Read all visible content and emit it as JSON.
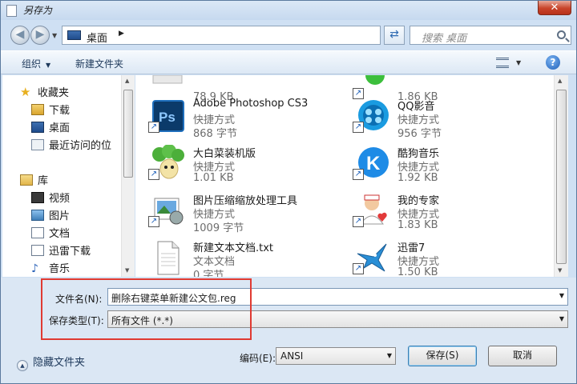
{
  "window": {
    "title": "另存为",
    "close_glyph": "✕"
  },
  "nav": {
    "address_location": "桌面",
    "search_placeholder": "搜索 桌面"
  },
  "toolbar": {
    "organize": "组织",
    "new_folder": "新建文件夹"
  },
  "sidebar": {
    "items": [
      {
        "label": "收藏夹",
        "icon": "star-icon"
      },
      {
        "label": "下载",
        "icon": "downloads-folder-icon"
      },
      {
        "label": "桌面",
        "icon": "desktop-icon"
      },
      {
        "label": "最近访问的位",
        "icon": "recent-places-icon"
      },
      {
        "label": "库",
        "icon": "libraries-icon"
      },
      {
        "label": "视频",
        "icon": "video-library-icon"
      },
      {
        "label": "图片",
        "icon": "pictures-library-icon"
      },
      {
        "label": "文档",
        "icon": "documents-library-icon"
      },
      {
        "label": "迅雷下载",
        "icon": "thunder-download-icon"
      },
      {
        "label": "音乐",
        "icon": "music-library-icon"
      }
    ]
  },
  "files": [
    {
      "name": "",
      "type": "",
      "size": "78.9 KB",
      "icon": "partial-file-icon"
    },
    {
      "name": "",
      "type": "",
      "size": "1.86 KB",
      "icon": "partial-green-app-icon"
    },
    {
      "name": "Adobe Photoshop CS3",
      "type": "快捷方式",
      "size": "868 字节",
      "icon": "photoshop-icon"
    },
    {
      "name": "QQ影音",
      "type": "快捷方式",
      "size": "956 字节",
      "icon": "qq-player-icon"
    },
    {
      "name": "大白菜装机版",
      "type": "快捷方式",
      "size": "1.01 KB",
      "icon": "dabaicai-icon"
    },
    {
      "name": "酷狗音乐",
      "type": "快捷方式",
      "size": "1.92 KB",
      "icon": "kugou-music-icon"
    },
    {
      "name": "图片压缩缩放处理工具",
      "type": "快捷方式",
      "size": "1009 字节",
      "icon": "image-compress-tool-icon"
    },
    {
      "name": "我的专家",
      "type": "快捷方式",
      "size": "1.83 KB",
      "icon": "my-expert-icon"
    },
    {
      "name": "新建文本文档.txt",
      "type": "文本文档",
      "size": "0 字节",
      "icon": "text-document-icon"
    },
    {
      "name": "迅雷7",
      "type": "快捷方式",
      "size": "1.50 KB",
      "icon": "thunder7-icon"
    }
  ],
  "form": {
    "filename_label": "文件名(N):",
    "filename_value": "删除右键菜单新建公文包.reg",
    "filetype_label": "保存类型(T):",
    "filetype_value": "所有文件 (*.*)",
    "hide_folders": "隐藏文件夹",
    "encoding_label": "编码(E):",
    "encoding_value": "ANSI",
    "save_button": "保存(S)",
    "cancel_button": "取消"
  },
  "colors": {
    "highlight_box": "#e03a32",
    "window_frame": "#cfe0f3"
  }
}
